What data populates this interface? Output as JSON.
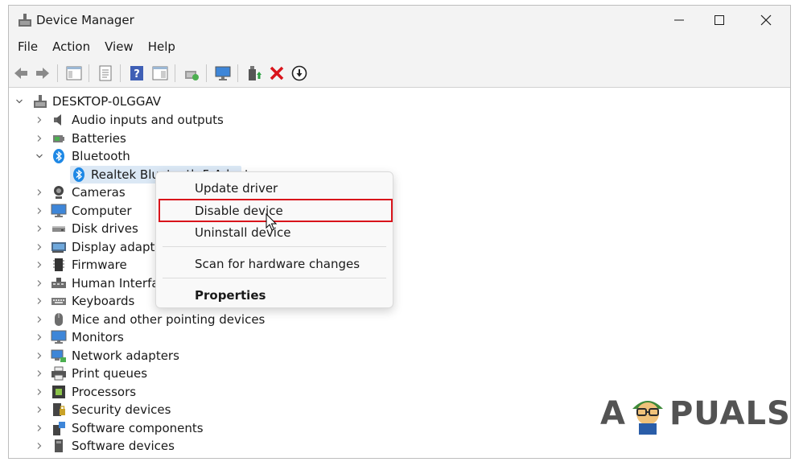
{
  "window": {
    "title": "Device Manager"
  },
  "menubar": {
    "items": [
      "File",
      "Action",
      "View",
      "Help"
    ]
  },
  "toolbar": {
    "buttons": [
      "back-icon",
      "forward-icon",
      "properties-pane-icon",
      "details-icon",
      "help-icon",
      "action-pane-icon",
      "scan-hardware-icon",
      "monitor-icon",
      "update-driver-icon",
      "uninstall-icon",
      "disable-icon"
    ]
  },
  "tree": {
    "root": "DESKTOP-0LGGAV",
    "nodes": [
      "Audio inputs and outputs",
      "Batteries",
      "Bluetooth",
      "Realtek Bluetooth 5 Adapter",
      "Cameras",
      "Computer",
      "Disk drives",
      "Display adapters",
      "Firmware",
      "Human Interface",
      "Keyboards",
      "Mice and other pointing devices",
      "Monitors",
      "Network adapters",
      "Print queues",
      "Processors",
      "Security devices",
      "Software components",
      "Software devices"
    ]
  },
  "context_menu": {
    "update": "Update driver",
    "disable": "Disable device",
    "uninstall": "Uninstall device",
    "scan": "Scan for hardware changes",
    "properties": "Properties"
  },
  "watermark": {
    "left": "A",
    "right": "PUALS"
  },
  "colors": {
    "accent": "#d9141b",
    "selection": "#dbe8f5",
    "bluetooth": "#1e88e5"
  }
}
